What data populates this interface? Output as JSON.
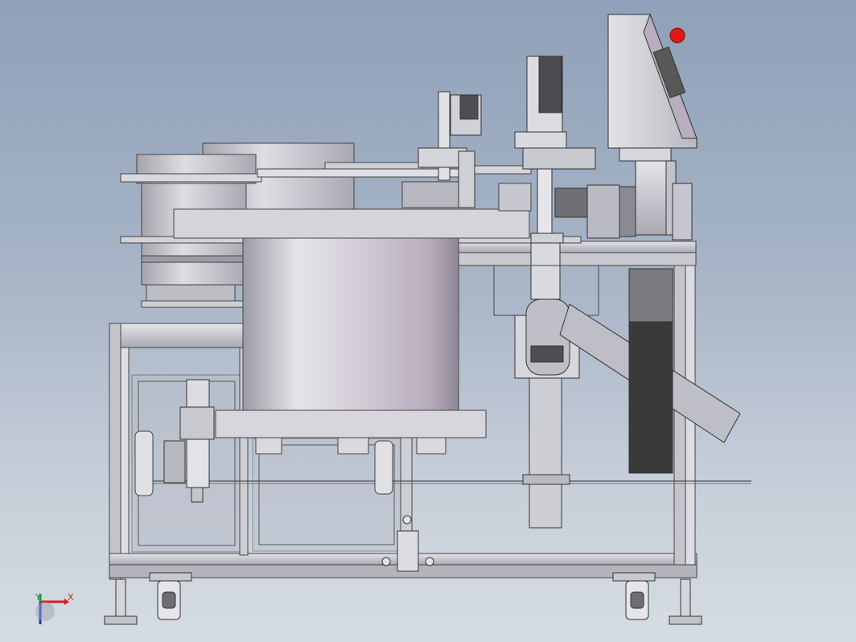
{
  "viewport": {
    "background_top": "#8fa0b8",
    "background_bottom": "#d6dce3"
  },
  "model": {
    "render_style": "shaded-with-edges",
    "view": "front",
    "components": [
      "frame",
      "vibratory-bowl-feeder",
      "control-panel",
      "emergency-stop",
      "linear-feed-track",
      "pick-and-place-unit",
      "discharge-chute",
      "pneumatic-filter-regulator",
      "caster-wheels",
      "leveling-feet"
    ],
    "colors": {
      "metal_light": "#dcdde3",
      "metal_mid": "#b8b9c2",
      "metal_shadow": "#8e8f99",
      "bowl_tint": "#c9bfcf",
      "dark_panel": "#3a3a3a",
      "estop_red": "#e01818"
    }
  },
  "triad": {
    "x_label": "X",
    "y_label": "Y",
    "x_color": "#d61f1f",
    "y_color": "#1f9a2a",
    "z_color": "#2430c8"
  }
}
